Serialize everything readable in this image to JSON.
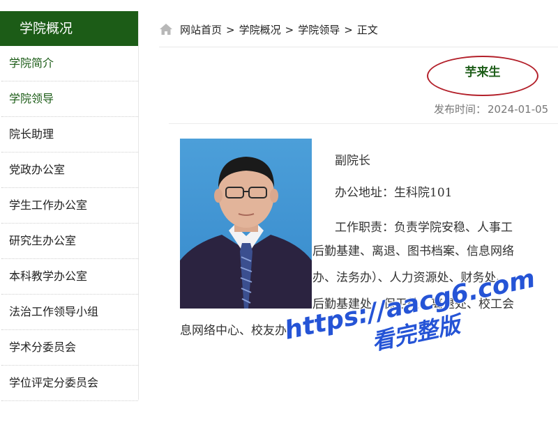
{
  "sidebar": {
    "title": "学院概况",
    "items": [
      {
        "label": "学院简介",
        "active": true
      },
      {
        "label": "学院领导",
        "active": true
      },
      {
        "label": "院长助理"
      },
      {
        "label": "党政办公室"
      },
      {
        "label": "学生工作办公室"
      },
      {
        "label": "研究生办公室"
      },
      {
        "label": "本科教学办公室"
      },
      {
        "label": "法治工作领导小组"
      },
      {
        "label": "学术分委员会"
      },
      {
        "label": "学位评定分委员会"
      }
    ]
  },
  "breadcrumb": {
    "items": [
      "网站首页",
      "学院概况",
      "学院领导",
      "正文"
    ],
    "separator": ">"
  },
  "article": {
    "title": "芋来生",
    "published_label": "发布时间：",
    "published_date": "2024-01-05",
    "body": {
      "position": "副院长",
      "office": "办公地址：生科院101",
      "duties_line1": "工作职责：负责学院安稳、人事工",
      "duties_line2": "后勤基建、离退、图书档案、信息网络",
      "duties_line3": "办、法务办）、人力资源处、财务处、",
      "duties_line4": "后勤基建处、保卫处、离退处、校工会",
      "duties_line5": "息网络中心、校友办。"
    }
  },
  "watermark": {
    "line1": "https://aacg6.com",
    "line2": "看完整版"
  },
  "colors": {
    "brand_green": "#1c5c17",
    "title_oval": "#b3202a",
    "watermark": "#2554d6"
  },
  "icons": {
    "home": "home-icon"
  }
}
